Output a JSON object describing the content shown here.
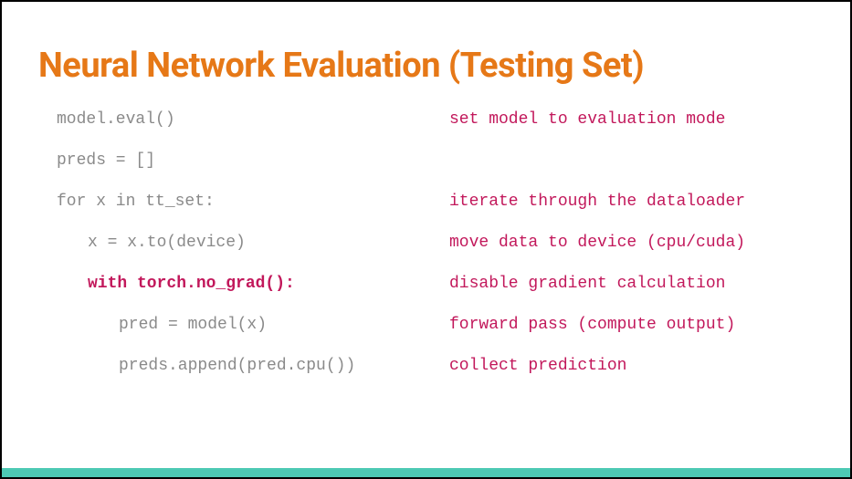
{
  "title": "Neural Network Evaluation (Testing Set)",
  "rows": [
    {
      "code": "model.eval()",
      "comment": "set model to evaluation mode",
      "indent": 0,
      "hl": false
    },
    {
      "code": "preds = []",
      "comment": "",
      "indent": 0,
      "hl": false
    },
    {
      "code": "for x in tt_set:",
      "comment": "iterate through the dataloader",
      "indent": 0,
      "hl": false
    },
    {
      "code": "x = x.to(device)",
      "comment": "move data to device (cpu/cuda)",
      "indent": 1,
      "hl": false
    },
    {
      "code": "with torch.no_grad():",
      "comment": "disable gradient calculation",
      "indent": 1,
      "hl": true
    },
    {
      "code": "pred = model(x)",
      "comment": "forward pass (compute output)",
      "indent": 2,
      "hl": false
    },
    {
      "code": "preds.append(pred.cpu())",
      "comment": "collect prediction",
      "indent": 2,
      "hl": false
    }
  ]
}
